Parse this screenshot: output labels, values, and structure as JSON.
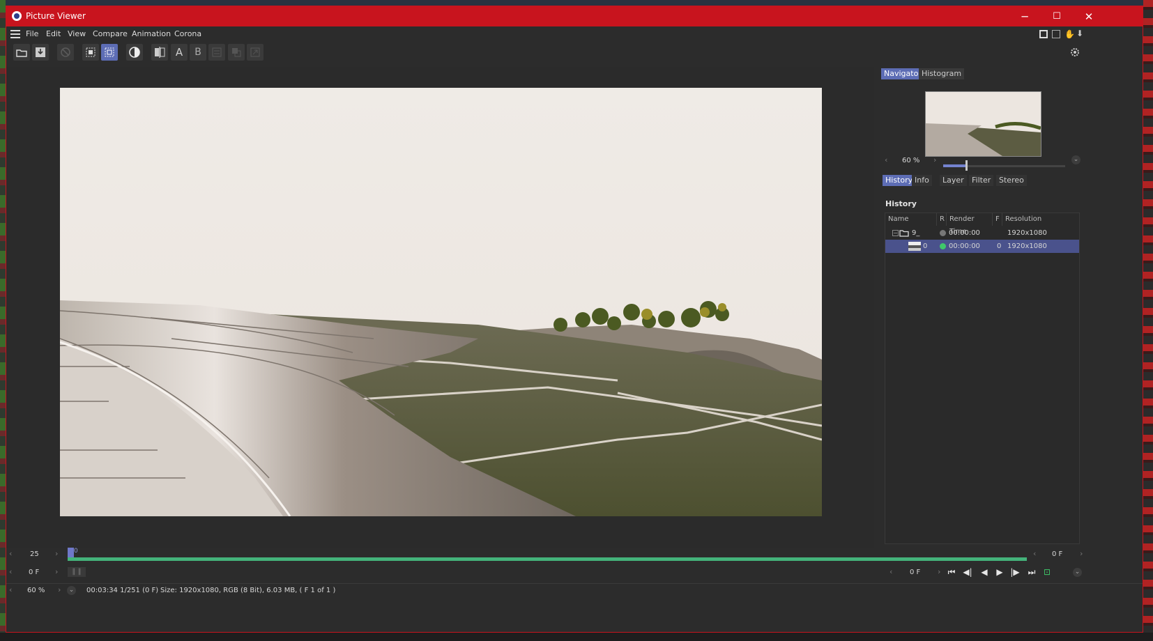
{
  "window": {
    "title": "Picture Viewer",
    "minimize": "─",
    "maximize": "☐",
    "close": "✕"
  },
  "menu": [
    "File",
    "Edit",
    "View",
    "Compare",
    "Animation",
    "Corona"
  ],
  "toolbar": {
    "buttons": [
      {
        "icon": "open-folder-icon"
      },
      {
        "icon": "save-icon"
      },
      {
        "icon": "stop-render-icon"
      },
      {
        "icon": "region-render-icon"
      },
      {
        "icon": "auto-zoom-icon"
      },
      {
        "icon": "contrast-icon"
      },
      {
        "icon": "compare-split-icon"
      },
      {
        "icon": "compare-a-icon",
        "label": "A"
      },
      {
        "icon": "compare-b-icon",
        "label": "B"
      },
      {
        "icon": "compare-mode-icon"
      },
      {
        "icon": "overlay-icon"
      },
      {
        "icon": "export-icon"
      }
    ]
  },
  "navigator": {
    "tabs": [
      "Navigator",
      "Histogram"
    ],
    "active_tab": "Navigator",
    "zoom_text": "60 %",
    "zoom_fraction": 0.19
  },
  "info_tabs": {
    "tabs": [
      "History",
      "Info",
      "Layer",
      "Filter",
      "Stereo"
    ],
    "active_tab": "History"
  },
  "history": {
    "heading": "History",
    "columns": [
      "Name",
      "R",
      "Render Time",
      "F",
      "Resolution"
    ],
    "rows": [
      {
        "name": "9_",
        "render_time": "00:00:00",
        "frame": "",
        "resolution": "1920x1080",
        "status": "gray",
        "selected": false
      },
      {
        "name": "0",
        "render_time": "00:00:00",
        "frame": "0",
        "resolution": "1920x1080",
        "status": "green",
        "selected": true
      }
    ]
  },
  "timeline": {
    "fps": "25",
    "start_frame": "0 F",
    "end_frame": "0 F",
    "marker_label": "0",
    "current_frame": "0 F"
  },
  "status": {
    "zoom": "60 %",
    "time": "00:03:34 1/251 (0 F)",
    "size_info": "Size: 1920x1080, RGB (8 Bit), 6.03 MB,  ( F 1 of 1 )"
  },
  "colors": {
    "accent": "#5d6db5",
    "title_bar": "#c8141e",
    "timeline_green": "#44b37a",
    "status_green": "#3fc86a"
  }
}
